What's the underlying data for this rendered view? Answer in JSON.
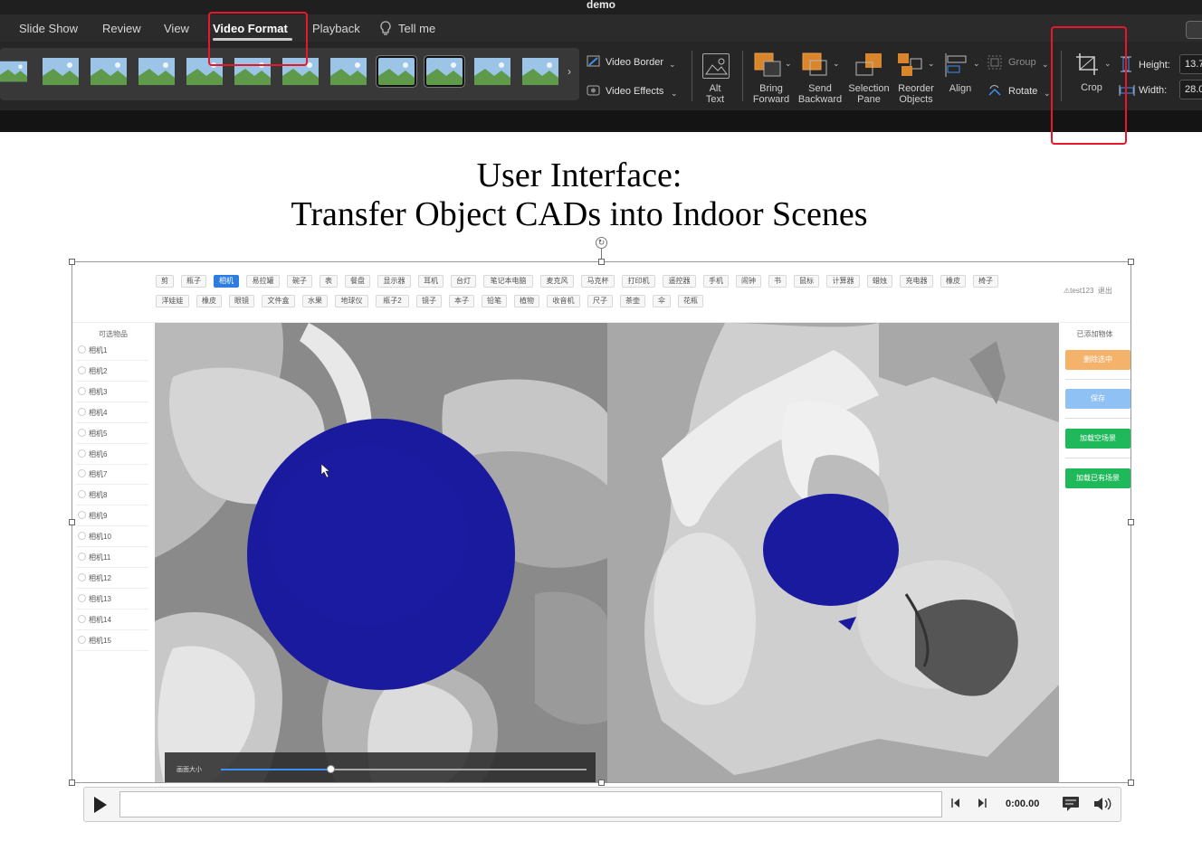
{
  "window": {
    "title": "demo"
  },
  "tabs": [
    {
      "label": "Slide Show"
    },
    {
      "label": "Review"
    },
    {
      "label": "View"
    },
    {
      "label": "Video Format"
    },
    {
      "label": "Playback"
    },
    {
      "label": "Tell me"
    }
  ],
  "ribbon": {
    "video_border": "Video Border",
    "video_effects": "Video Effects",
    "alt_text": [
      "Alt",
      "Text"
    ],
    "bring_forward": [
      "Bring",
      "Forward"
    ],
    "send_backward": [
      "Send",
      "Backward"
    ],
    "selection_pane": [
      "Selection",
      "Pane"
    ],
    "reorder_objects": [
      "Reorder",
      "Objects"
    ],
    "align": "Align",
    "group": "Group",
    "rotate": "Rotate",
    "crop": "Crop",
    "height_label": "Height:",
    "height_value": "13.7",
    "width_label": "Width:",
    "width_value": "28.0"
  },
  "slide": {
    "title_line1": "User Interface:",
    "title_line2": "Transfer Object CADs into Indoor Scenes"
  },
  "app": {
    "categories_row1": [
      "剪",
      "瓶子",
      "相机",
      "易拉罐",
      "碗子",
      "表",
      "餐盘",
      "显示器",
      "耳机",
      "台灯",
      "笔记本电脑",
      "麦克风",
      "马克杯",
      "打印机",
      "遥控器",
      "手机",
      "闹钟",
      "书",
      "鼠标",
      "计算器",
      "蜡烛",
      "充电器",
      "橡皮",
      "椅子"
    ],
    "categories_row2": [
      "洋娃娃",
      "橡皮",
      "眼镜",
      "文件盒",
      "水果",
      "地球仪",
      "瓶子2",
      "镜子",
      "本子",
      "铅笔",
      "植物",
      "收音机",
      "尺子",
      "茶壶",
      "伞",
      "花瓶"
    ],
    "selected_category": "相机",
    "user": "⚠test123",
    "logout": "退出",
    "left_panel_title": "可选物品",
    "items": [
      "相机1",
      "相机2",
      "相机3",
      "相机4",
      "相机5",
      "相机6",
      "相机7",
      "相机8",
      "相机9",
      "相机10",
      "相机11",
      "相机12",
      "相机13",
      "相机14",
      "相机15"
    ],
    "slider_label": "画面大小",
    "slider_value": 0.3,
    "right_panel_title": "已添加物体",
    "buttons": [
      {
        "label": "删除选中",
        "color": "#f5b26b"
      },
      {
        "label": "保存",
        "color": "#8fc1f5"
      },
      {
        "label": "加载空场景",
        "color": "#1fb85a"
      },
      {
        "label": "加载已有场景",
        "color": "#1fb85a"
      }
    ],
    "object_color": "#1a1a9e"
  },
  "player": {
    "time": "0:00.00"
  },
  "colors": {
    "annotation_red": "#e8182c",
    "ribbon_bg": "#262626"
  }
}
